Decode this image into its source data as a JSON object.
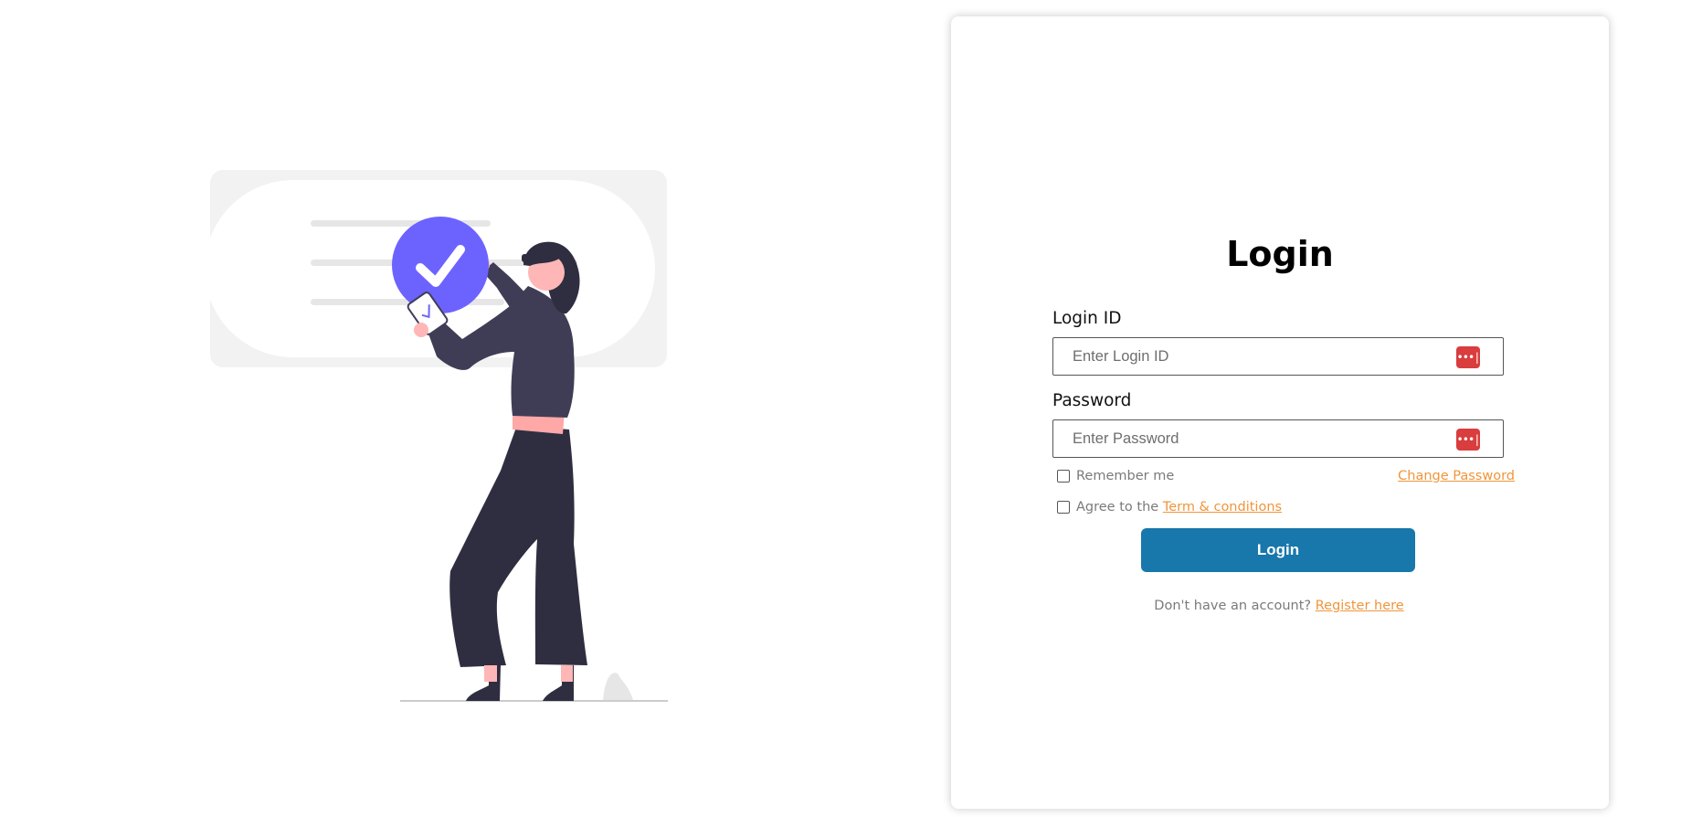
{
  "login": {
    "title": "Login",
    "login_id_label": "Login ID",
    "login_id_placeholder": "Enter Login ID",
    "password_label": "Password",
    "password_placeholder": "Enter Password",
    "password_icon": "•••|",
    "remember_me": "Remember me",
    "change_password": "Change Password",
    "agree_prefix": "Agree to the",
    "terms_link": "Term & conditions",
    "submit_label": "Login",
    "no_account_text": "Don't have an account?",
    "register_link": "Register here"
  },
  "illustration": {
    "name": "person-checking-login-illustration",
    "icon": "checkmark-circle-icon"
  },
  "colors": {
    "accent_button": "#1877ab",
    "link": "#f0953a",
    "checkmark_circle": "#6c63ff",
    "password_manager_icon": "#d93d3d"
  }
}
